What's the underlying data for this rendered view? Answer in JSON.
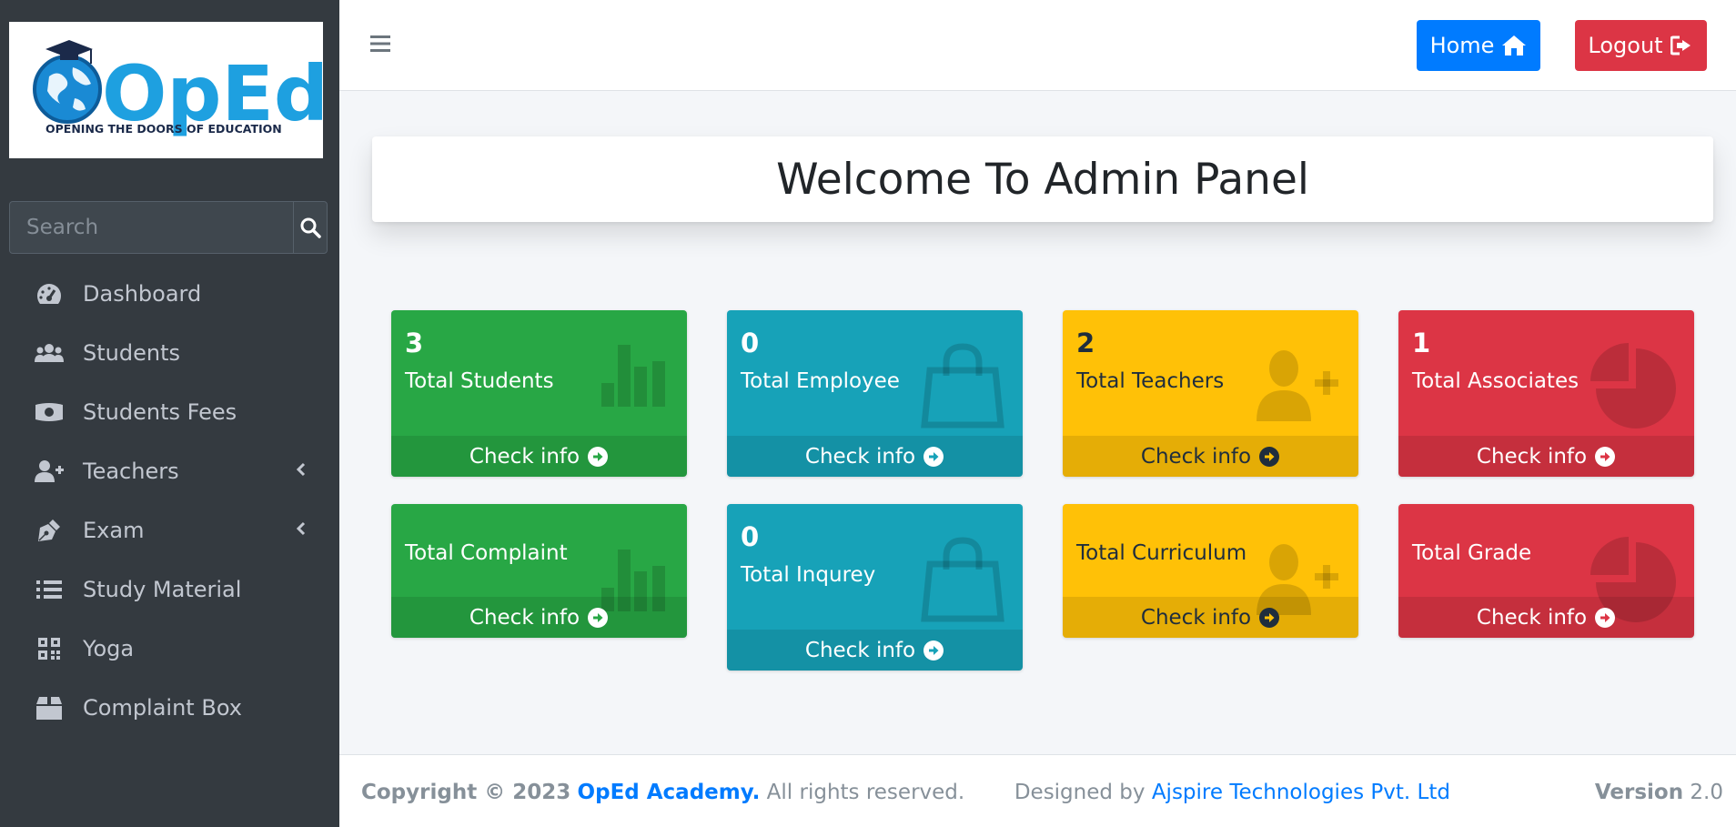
{
  "sidebar": {
    "logo": {
      "text": "OpEd",
      "tagline": "OPENING THE DOORS OF EDUCATION"
    },
    "search": {
      "placeholder": "Search",
      "icon": "search-icon"
    },
    "items": [
      {
        "label": "Dashboard",
        "icon": "tachometer-icon",
        "has_submenu": false
      },
      {
        "label": "Students",
        "icon": "users-icon",
        "has_submenu": false
      },
      {
        "label": "Students Fees",
        "icon": "money-bill-icon",
        "has_submenu": false
      },
      {
        "label": "Teachers",
        "icon": "user-plus-icon",
        "has_submenu": true
      },
      {
        "label": "Exam",
        "icon": "pen-nib-icon",
        "has_submenu": true
      },
      {
        "label": "Study Material",
        "icon": "list-icon",
        "has_submenu": false
      },
      {
        "label": "Yoga",
        "icon": "qrcode-icon",
        "has_submenu": false
      },
      {
        "label": "Complaint Box",
        "icon": "box-icon",
        "has_submenu": false
      }
    ]
  },
  "header": {
    "menu_icon": "hamburger-icon",
    "home_label": "Home",
    "logout_label": "Logout"
  },
  "main": {
    "welcome_title": "Welcome To Admin Panel",
    "boxes": [
      {
        "value": "3",
        "label": "Total Students",
        "footer": "Check info",
        "color": "#28a745",
        "icon": "bar-chart-icon"
      },
      {
        "value": "0",
        "label": "Total Employee",
        "footer": "Check info",
        "color": "#17a2b8",
        "icon": "shopping-bag-icon"
      },
      {
        "value": "2",
        "label": "Total Teachers",
        "footer": "Check info",
        "color": "#ffc107",
        "icon": "user-plus-icon"
      },
      {
        "value": "1",
        "label": "Total Associates",
        "footer": "Check info",
        "color": "#dc3545",
        "icon": "pie-chart-icon"
      },
      {
        "value": "",
        "label": "Total Complaint",
        "footer": "Check info",
        "color": "#28a745",
        "icon": "bar-chart-icon"
      },
      {
        "value": "0",
        "label": "Total Inqurey",
        "footer": "Check info",
        "color": "#17a2b8",
        "icon": "shopping-bag-icon"
      },
      {
        "value": "",
        "label": "Total Curriculum",
        "footer": "Check info",
        "color": "#ffc107",
        "icon": "user-plus-icon"
      },
      {
        "value": "",
        "label": "Total Grade",
        "footer": "Check info",
        "color": "#dc3545",
        "icon": "pie-chart-icon"
      }
    ]
  },
  "footer": {
    "copyright": "Copyright © 2023",
    "org_link": "OpEd Academy.",
    "rights": "All rights reserved.",
    "designed_by": "Designed by",
    "designer_link": "Ajspire Technologies Pvt. Ltd",
    "version_label": "Version",
    "version_value": "2.0"
  }
}
